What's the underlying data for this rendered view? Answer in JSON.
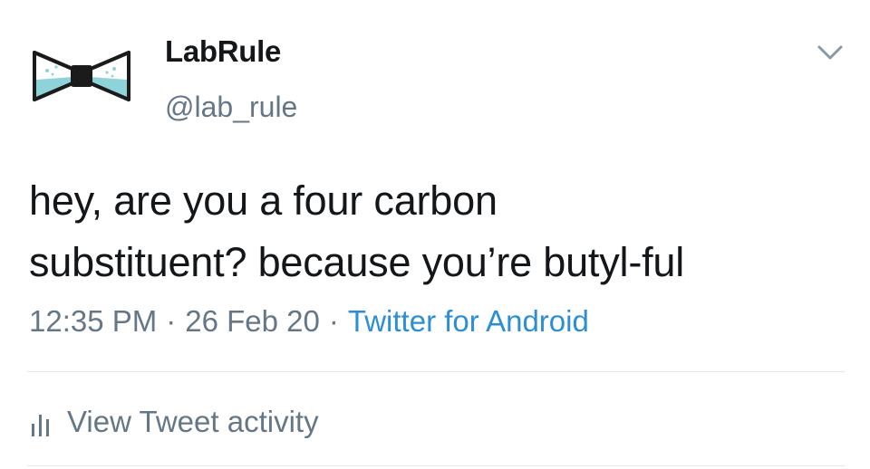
{
  "user": {
    "display_name": "LabRule",
    "handle": "@lab_rule",
    "avatar_icon": "bowtie-flask-logo-icon"
  },
  "tweet": {
    "text_line1": "hey, are you a four carbon",
    "text_line2": "substituent? because you’re butyl-ful",
    "time": "12:35 PM",
    "date": "26 Feb 20",
    "separator": "·",
    "source": "Twitter for Android"
  },
  "actions": {
    "caret_icon": "chevron-down-icon",
    "activity_icon": "bar-chart-icon",
    "activity_label": "View Tweet activity"
  },
  "colors": {
    "text": "#14171a",
    "secondary": "#657786",
    "link": "#2b8fd6",
    "divider": "#e1e8ed",
    "avatar_liquid": "#8fd3da"
  }
}
